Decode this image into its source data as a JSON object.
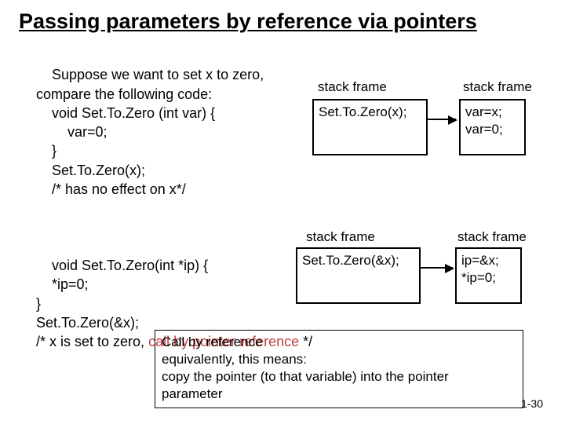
{
  "title": "Passing parameters by reference via pointers",
  "code1": {
    "l1": "Suppose we want to set x to zero,",
    "l2": "compare the following code:",
    "l3": "    void Set.To.Zero (int var) {",
    "l4": "        var=0;",
    "l5": "    }",
    "l6": "    Set.To.Zero(x);",
    "l7": "    /* has no effect on x*/"
  },
  "code2": {
    "l1": "void Set.To.Zero(int *ip) {",
    "l2": "    *ip=0;",
    "l3": "}",
    "l4": "Set.To.Zero(&x);",
    "l5a": "/* x is set to zero, ",
    "l5b": "call by pointer reference ",
    "l5c": "*/"
  },
  "diagram1": {
    "label1": "stack frame",
    "box1": "Set.To.Zero(x);",
    "label2": "stack frame",
    "box2": "var=x;\nvar=0;"
  },
  "diagram2": {
    "label1": "stack frame",
    "box1": "Set.To.Zero(&x);",
    "label2": "stack frame",
    "box2": "ip=&x;\n*ip=0;"
  },
  "summary": {
    "l1": "Call by reference",
    "l2": "equivalently, this means:",
    "l3": "copy the pointer (to that variable) into the pointer",
    "l4": "parameter"
  },
  "slide_number": "1-30"
}
